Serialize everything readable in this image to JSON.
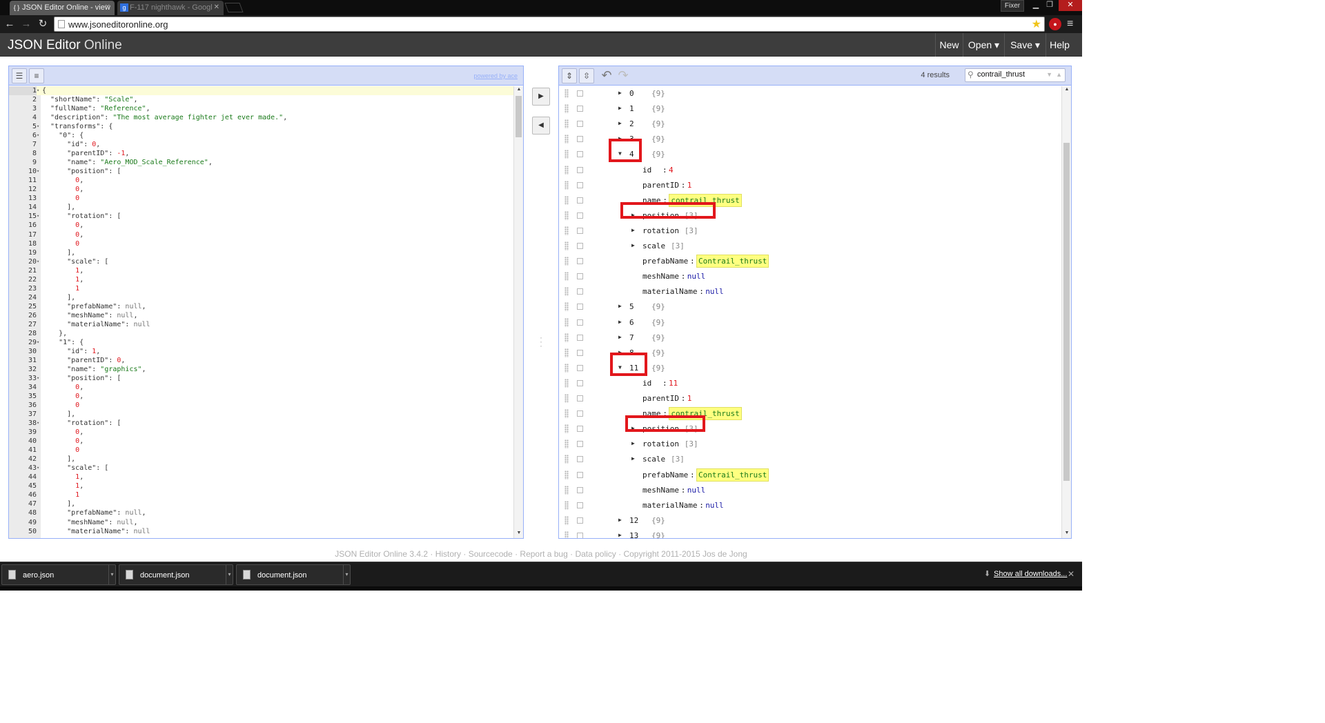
{
  "browser": {
    "tabs": [
      {
        "label": "JSON Editor Online - view",
        "icon": "{ }",
        "active": true
      },
      {
        "label": "F-117 nighthawk - Googl",
        "icon": "g",
        "active": false
      }
    ],
    "user_label": "Fixer",
    "url": "www.jsoneditoronline.org"
  },
  "app": {
    "title_main": "JSON Editor",
    "title_light": "Online",
    "menu": {
      "new": "New",
      "open": "Open ▾",
      "save": "Save ▾",
      "help": "Help"
    }
  },
  "code_editor": {
    "powered_by": "powered by ace",
    "lines": [
      [
        [
          "{",
          "k"
        ]
      ],
      [
        [
          "  \"shortName\": ",
          "k"
        ],
        [
          "\"Scale\"",
          "s"
        ],
        [
          ",",
          "k"
        ]
      ],
      [
        [
          "  \"fullName\": ",
          "k"
        ],
        [
          "\"Reference\"",
          "s"
        ],
        [
          ",",
          "k"
        ]
      ],
      [
        [
          "  \"description\": ",
          "k"
        ],
        [
          "\"The most average fighter jet ever made.\"",
          "s"
        ],
        [
          ",",
          "k"
        ]
      ],
      [
        [
          "  \"transforms\": {",
          "k"
        ]
      ],
      [
        [
          "    \"0\": {",
          "k"
        ]
      ],
      [
        [
          "      \"id\": ",
          "k"
        ],
        [
          "0",
          "n"
        ],
        [
          ",",
          "k"
        ]
      ],
      [
        [
          "      \"parentID\": ",
          "k"
        ],
        [
          "-1",
          "n"
        ],
        [
          ",",
          "k"
        ]
      ],
      [
        [
          "      \"name\": ",
          "k"
        ],
        [
          "\"Aero_MOD_Scale_Reference\"",
          "s"
        ],
        [
          ",",
          "k"
        ]
      ],
      [
        [
          "      \"position\": [",
          "k"
        ]
      ],
      [
        [
          "        ",
          "k"
        ],
        [
          "0",
          "n"
        ],
        [
          ",",
          "k"
        ]
      ],
      [
        [
          "        ",
          "k"
        ],
        [
          "0",
          "n"
        ],
        [
          ",",
          "k"
        ]
      ],
      [
        [
          "        ",
          "k"
        ],
        [
          "0",
          "n"
        ]
      ],
      [
        [
          "      ],",
          "k"
        ]
      ],
      [
        [
          "      \"rotation\": [",
          "k"
        ]
      ],
      [
        [
          "        ",
          "k"
        ],
        [
          "0",
          "n"
        ],
        [
          ",",
          "k"
        ]
      ],
      [
        [
          "        ",
          "k"
        ],
        [
          "0",
          "n"
        ],
        [
          ",",
          "k"
        ]
      ],
      [
        [
          "        ",
          "k"
        ],
        [
          "0",
          "n"
        ]
      ],
      [
        [
          "      ],",
          "k"
        ]
      ],
      [
        [
          "      \"scale\": [",
          "k"
        ]
      ],
      [
        [
          "        ",
          "k"
        ],
        [
          "1",
          "n"
        ],
        [
          ",",
          "k"
        ]
      ],
      [
        [
          "        ",
          "k"
        ],
        [
          "1",
          "n"
        ],
        [
          ",",
          "k"
        ]
      ],
      [
        [
          "        ",
          "k"
        ],
        [
          "1",
          "n"
        ]
      ],
      [
        [
          "      ],",
          "k"
        ]
      ],
      [
        [
          "      \"prefabName\": ",
          "k"
        ],
        [
          "null",
          "nl"
        ],
        [
          ",",
          "k"
        ]
      ],
      [
        [
          "      \"meshName\": ",
          "k"
        ],
        [
          "null",
          "nl"
        ],
        [
          ",",
          "k"
        ]
      ],
      [
        [
          "      \"materialName\": ",
          "k"
        ],
        [
          "null",
          "nl"
        ]
      ],
      [
        [
          "    },",
          "k"
        ]
      ],
      [
        [
          "    \"1\": {",
          "k"
        ]
      ],
      [
        [
          "      \"id\": ",
          "k"
        ],
        [
          "1",
          "n"
        ],
        [
          ",",
          "k"
        ]
      ],
      [
        [
          "      \"parentID\": ",
          "k"
        ],
        [
          "0",
          "n"
        ],
        [
          ",",
          "k"
        ]
      ],
      [
        [
          "      \"name\": ",
          "k"
        ],
        [
          "\"graphics\"",
          "s"
        ],
        [
          ",",
          "k"
        ]
      ],
      [
        [
          "      \"position\": [",
          "k"
        ]
      ],
      [
        [
          "        ",
          "k"
        ],
        [
          "0",
          "n"
        ],
        [
          ",",
          "k"
        ]
      ],
      [
        [
          "        ",
          "k"
        ],
        [
          "0",
          "n"
        ],
        [
          ",",
          "k"
        ]
      ],
      [
        [
          "        ",
          "k"
        ],
        [
          "0",
          "n"
        ]
      ],
      [
        [
          "      ],",
          "k"
        ]
      ],
      [
        [
          "      \"rotation\": [",
          "k"
        ]
      ],
      [
        [
          "        ",
          "k"
        ],
        [
          "0",
          "n"
        ],
        [
          ",",
          "k"
        ]
      ],
      [
        [
          "        ",
          "k"
        ],
        [
          "0",
          "n"
        ],
        [
          ",",
          "k"
        ]
      ],
      [
        [
          "        ",
          "k"
        ],
        [
          "0",
          "n"
        ]
      ],
      [
        [
          "      ],",
          "k"
        ]
      ],
      [
        [
          "      \"scale\": [",
          "k"
        ]
      ],
      [
        [
          "        ",
          "k"
        ],
        [
          "1",
          "n"
        ],
        [
          ",",
          "k"
        ]
      ],
      [
        [
          "        ",
          "k"
        ],
        [
          "1",
          "n"
        ],
        [
          ",",
          "k"
        ]
      ],
      [
        [
          "        ",
          "k"
        ],
        [
          "1",
          "n"
        ]
      ],
      [
        [
          "      ],",
          "k"
        ]
      ],
      [
        [
          "      \"prefabName\": ",
          "k"
        ],
        [
          "null",
          "nl"
        ],
        [
          ",",
          "k"
        ]
      ],
      [
        [
          "      \"meshName\": ",
          "k"
        ],
        [
          "null",
          "nl"
        ],
        [
          ",",
          "k"
        ]
      ],
      [
        [
          "      \"materialName\": ",
          "k"
        ],
        [
          "null",
          "nl"
        ]
      ]
    ],
    "foldable_lines": [
      1,
      5,
      6,
      10,
      15,
      20,
      29,
      33,
      38,
      43
    ]
  },
  "tree_editor": {
    "search_results": "4 results",
    "search_query": "contrail_thrust",
    "rows": [
      {
        "key": "0",
        "count": "{9}",
        "level": 0,
        "exp": "closed"
      },
      {
        "key": "1",
        "count": "{9}",
        "level": 0,
        "exp": "closed"
      },
      {
        "key": "2",
        "count": "{9}",
        "level": 0,
        "exp": "closed"
      },
      {
        "key": "3",
        "count": "{9}",
        "level": 0,
        "exp": "closed"
      },
      {
        "key": "4",
        "count": "{9}",
        "level": 0,
        "exp": "open",
        "hl": true
      },
      {
        "key": "id",
        "value": "4",
        "vtype": "num",
        "level": 1
      },
      {
        "key": "parentID",
        "value": "1",
        "vtype": "num",
        "level": 1
      },
      {
        "key": "name",
        "value": "contrail_thrust",
        "vtype": "str",
        "level": 1
      },
      {
        "key": "position",
        "count": "[3]",
        "level": 1,
        "exp": "closed",
        "hl": true
      },
      {
        "key": "rotation",
        "count": "[3]",
        "level": 1,
        "exp": "closed"
      },
      {
        "key": "scale",
        "count": "[3]",
        "level": 1,
        "exp": "closed"
      },
      {
        "key": "prefabName",
        "value": "Contrail_thrust",
        "vtype": "str",
        "level": 1
      },
      {
        "key": "meshName",
        "value": "null",
        "vtype": "nul",
        "level": 1
      },
      {
        "key": "materialName",
        "value": "null",
        "vtype": "nul",
        "level": 1
      },
      {
        "key": "5",
        "count": "{9}",
        "level": 0,
        "exp": "closed"
      },
      {
        "key": "6",
        "count": "{9}",
        "level": 0,
        "exp": "closed"
      },
      {
        "key": "7",
        "count": "{9}",
        "level": 0,
        "exp": "closed"
      },
      {
        "key": "8",
        "count": "{9}",
        "level": 0,
        "exp": "closed"
      },
      {
        "key": "11",
        "count": "{9}",
        "level": 0,
        "exp": "open",
        "hl": true
      },
      {
        "key": "id",
        "value": "11",
        "vtype": "num",
        "level": 1
      },
      {
        "key": "parentID",
        "value": "1",
        "vtype": "num",
        "level": 1
      },
      {
        "key": "name",
        "value": "contrail_thrust",
        "vtype": "str",
        "level": 1
      },
      {
        "key": "position",
        "count": "[3]",
        "level": 1,
        "exp": "closed",
        "hl": true
      },
      {
        "key": "rotation",
        "count": "[3]",
        "level": 1,
        "exp": "closed"
      },
      {
        "key": "scale",
        "count": "[3]",
        "level": 1,
        "exp": "closed"
      },
      {
        "key": "prefabName",
        "value": "Contrail_thrust",
        "vtype": "str",
        "level": 1
      },
      {
        "key": "meshName",
        "value": "null",
        "vtype": "nul",
        "level": 1
      },
      {
        "key": "materialName",
        "value": "null",
        "vtype": "nul",
        "level": 1
      },
      {
        "key": "12",
        "count": "{9}",
        "level": 0,
        "exp": "closed"
      },
      {
        "key": "13",
        "count": "{9}",
        "level": 0,
        "exp": "closed"
      }
    ]
  },
  "footer": "JSON Editor Online 3.4.2 · History · Sourcecode · Report a bug · Data policy · Copyright 2011-2015 Jos de Jong",
  "downloads": {
    "items": [
      "aero.json",
      "document.json",
      "document.json"
    ],
    "show_all": "Show all downloads..."
  },
  "colors": {
    "accent": "#97b0f8",
    "highlight": "#e2171c",
    "header": "#3d3d3d"
  }
}
